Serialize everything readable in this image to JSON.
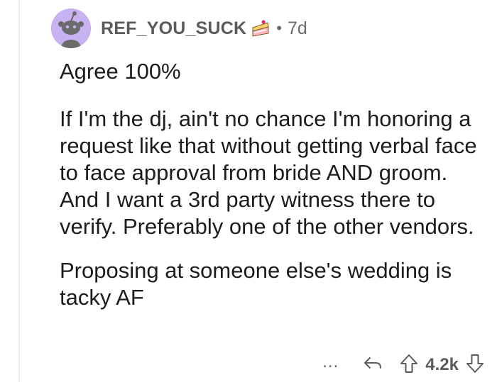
{
  "comment": {
    "username": "REF_YOU_SUCK",
    "separator": "•",
    "age": "7d",
    "paragraphs": [
      "Agree 100%",
      "If I'm the dj, ain't no chance I'm honoring a request like that without getting verbal face to face approval from bride AND groom. And I want a 3rd party witness there to verify. Preferably one of the other vendors.",
      "Proposing at someone else's wedding is tacky AF"
    ],
    "flair_icon": "cake-slice-icon",
    "avatar_icon": "snoo-avatar-icon"
  },
  "actions": {
    "more_label": "...",
    "score": "4.2k",
    "reply_icon": "reply-arrow-icon",
    "upvote_icon": "upvote-arrow-icon",
    "downvote_icon": "downvote-arrow-icon"
  },
  "colors": {
    "avatar_bg": "#c9b2f2",
    "username": "#5b5b5b",
    "text": "#1c1c1c",
    "thread_line": "#ececec"
  }
}
